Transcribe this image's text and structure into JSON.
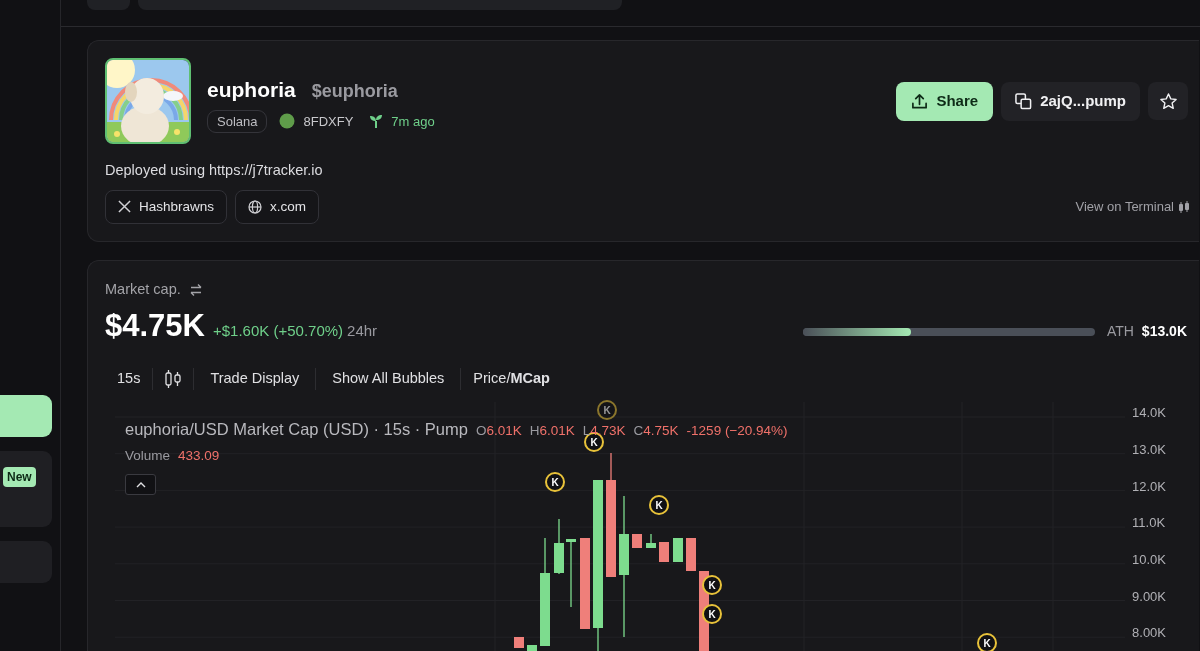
{
  "sidebar": {
    "items": [
      {
        "selected": true
      },
      {
        "selected": false,
        "badge": "New"
      },
      {
        "selected": false
      }
    ]
  },
  "token": {
    "name": "euphoria",
    "ticker": "$euphoria",
    "chain": "Solana",
    "creator": "8FDXFY",
    "age": "7m ago",
    "share_label": "Share",
    "address": "2ajQ...pump",
    "description": "Deployed using https://j7tracker.io",
    "links": [
      {
        "kind": "x",
        "label": "Hashbrawns"
      },
      {
        "kind": "web",
        "label": "x.com"
      }
    ],
    "terminal_link": "View on Terminal"
  },
  "market": {
    "label": "Market cap.",
    "value": "$4.75K",
    "change": "+$1.60K (+50.70%)",
    "period": "24hr",
    "level": 0.37,
    "ath_label": "ATH",
    "ath_value": "$13.0K"
  },
  "chart_toolbar": {
    "interval": "15s",
    "items": [
      "Trade Display",
      "Show All Bubbles"
    ],
    "toggle": "Price/**MCap**"
  },
  "chart": {
    "title": "euphoria/USD Market Cap (USD) · 15s · Pump",
    "ohlc": [
      {
        "key": "O",
        "value": "6.01K"
      },
      {
        "key": "H",
        "value": "6.01K"
      },
      {
        "key": "L",
        "value": "4.73K"
      },
      {
        "key": "C",
        "value": "4.75K"
      }
    ],
    "change": "-1259 (−20.94%)",
    "volume_label": "Volume",
    "volume_value": "433.09",
    "y_axis": [
      "14.0K",
      "13.0K",
      "12.0K",
      "11.0K",
      "10.0K",
      "9.00K",
      "8.00K"
    ],
    "bubbles": [
      {
        "label": "K"
      },
      {
        "label": "K"
      },
      {
        "label": "K"
      },
      {
        "label": "K"
      },
      {
        "label": "K"
      },
      {
        "label": "K"
      },
      {
        "label": "K"
      }
    ]
  }
}
